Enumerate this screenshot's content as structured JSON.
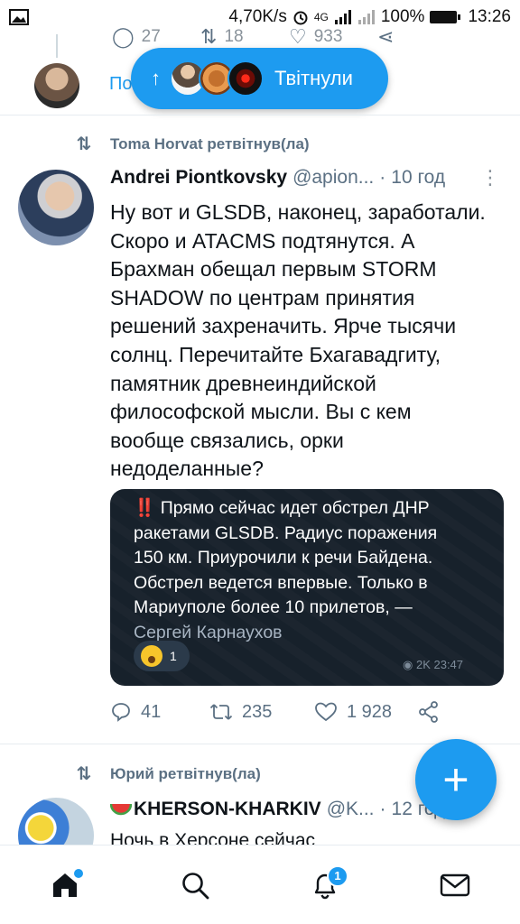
{
  "status_bar": {
    "speed": "4,70K/s",
    "network": "4G",
    "battery": "100%",
    "time": "13:26"
  },
  "previous_tweet": {
    "reply_count": "27",
    "retweet_count": "18",
    "like_count": "933",
    "show_more_fragment": "По"
  },
  "new_tweets_pill": {
    "label": "Твітнули"
  },
  "tweet": {
    "retweeted_by": "Toma Horvat ретвітнув(ла)",
    "author_name": "Andrei Piontkovsky",
    "author_handle": "@apion...",
    "time": "10 год",
    "text_lines": [
      "Ну вот и GLSDB, наконец, заработали.",
      "Скоро и ATACMS подтянутся. А",
      "Брахман обещал первым STORM",
      "SHADOW по центрам принятия",
      "решений захреначить. Ярче тысячи",
      "солнц. Перечитайте Бхагавадгиту,",
      "памятник древнеиндийской",
      "философской мысли. Вы с кем",
      "вообще связались, орки",
      "недоделанные?"
    ],
    "media": {
      "bang": "‼️",
      "lines": [
        "Прямо сейчас идет обстрел ДНР",
        "ракетами GLSDB. Радиус поражения",
        "150 км. Приурочили к речи Байдена.",
        "Обстрел ведется впервые. Только в",
        "Мариуполе более 10 прилетов, —"
      ],
      "author": "Сергей Карнаухов",
      "reaction_count": "1",
      "views_time": "2K 23:47"
    },
    "reply_count": "41",
    "retweet_count": "235",
    "like_count": "1 928"
  },
  "next_tweet": {
    "retweeted_by": "Юрий ретвітнув(ла)",
    "author_name": "KHERSON-KHARKIV",
    "author_handle": "@K...",
    "time": "12 год",
    "text_start": "Ночь в Херсоне сейчас"
  },
  "bottom_nav": {
    "notifications_badge": "1"
  },
  "colors": {
    "accent": "#1d9bf0",
    "secondary_text": "#5b7083",
    "media_background": "#17212b"
  }
}
